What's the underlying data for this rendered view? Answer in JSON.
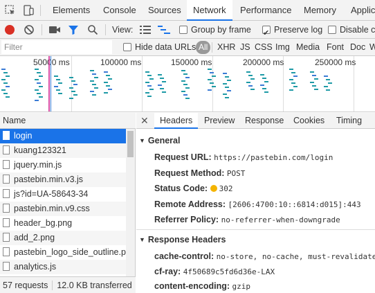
{
  "devtools": {
    "tabs": [
      {
        "label": "Elements"
      },
      {
        "label": "Console"
      },
      {
        "label": "Sources"
      },
      {
        "label": "Network"
      },
      {
        "label": "Performance"
      },
      {
        "label": "Memory"
      },
      {
        "label": "Applic"
      }
    ],
    "active_tab": "Network"
  },
  "toolbar": {
    "view_label": "View:",
    "group_by_frame": "Group by frame",
    "preserve_log": "Preserve log",
    "disable_cache": "Disable ca",
    "record_color": "#d93025",
    "filter_color": "#1a73e8"
  },
  "filterbar": {
    "placeholder": "Filter",
    "hide_data_urls": "Hide data URLs",
    "types": [
      "All",
      "XHR",
      "JS",
      "CSS",
      "Img",
      "Media",
      "Font",
      "Doc",
      "W"
    ]
  },
  "overview": {
    "ticks": [
      "50000 ms",
      "100000 ms",
      "150000 ms",
      "200000 ms",
      "250000 ms"
    ]
  },
  "requests": {
    "header": "Name",
    "items": [
      {
        "name": "login"
      },
      {
        "name": "kuang123321"
      },
      {
        "name": "jquery.min.js"
      },
      {
        "name": "pastebin.min.v3.js"
      },
      {
        "name": "js?id=UA-58643-34"
      },
      {
        "name": "pastebin.min.v9.css"
      },
      {
        "name": "header_bg.png"
      },
      {
        "name": "add_2.png"
      },
      {
        "name": "pastebin_logo_side_outline.pn"
      },
      {
        "name": "analytics.js"
      }
    ],
    "selected": 0,
    "status_requests": "57 requests",
    "status_transferred": "12.0 KB transferred"
  },
  "details": {
    "tabs": [
      "Headers",
      "Preview",
      "Response",
      "Cookies",
      "Timing"
    ],
    "active": "Headers",
    "general_title": "General",
    "general": [
      {
        "key": "Request URL:",
        "value": "https://pastebin.com/login"
      },
      {
        "key": "Request Method:",
        "value": "POST"
      },
      {
        "key": "Status Code:",
        "value": "302"
      },
      {
        "key": "Remote Address:",
        "value": "[2606:4700:10::6814:d015]:443"
      },
      {
        "key": "Referrer Policy:",
        "value": "no-referrer-when-downgrade"
      }
    ],
    "response_title": "Response Headers",
    "response": [
      {
        "key": "cache-control:",
        "value": "no-store, no-cache, must-revalidate"
      },
      {
        "key": "cf-ray:",
        "value": "4f50689c5fd6d36e-LAX"
      },
      {
        "key": "content-encoding:",
        "value": "gzip"
      }
    ]
  }
}
